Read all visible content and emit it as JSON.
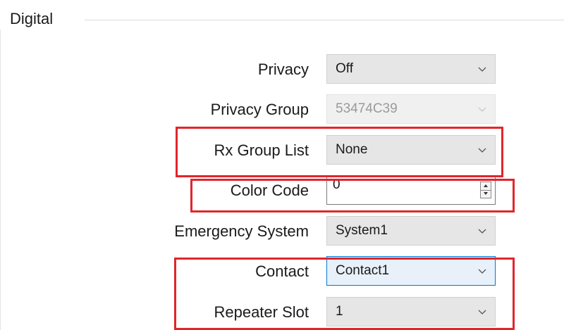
{
  "group": {
    "title": "Digital"
  },
  "fields": {
    "privacy": {
      "label": "Privacy",
      "value": "Off"
    },
    "privacy_group": {
      "label": "Privacy Group",
      "value": "53474C39"
    },
    "rx_group_list": {
      "label": "Rx Group List",
      "value": "None"
    },
    "color_code": {
      "label": "Color Code",
      "value": "0"
    },
    "emergency_system": {
      "label": "Emergency System",
      "value": "System1"
    },
    "contact": {
      "label": "Contact",
      "value": "Contact1"
    },
    "repeater_slot": {
      "label": "Repeater Slot",
      "value": "1"
    }
  },
  "icons": {
    "dropdown": "chevron-down-icon",
    "spin_up": "spin-up-icon",
    "spin_down": "spin-down-icon"
  },
  "colors": {
    "highlight": "#e0262b",
    "focus_border": "#0078d7"
  }
}
